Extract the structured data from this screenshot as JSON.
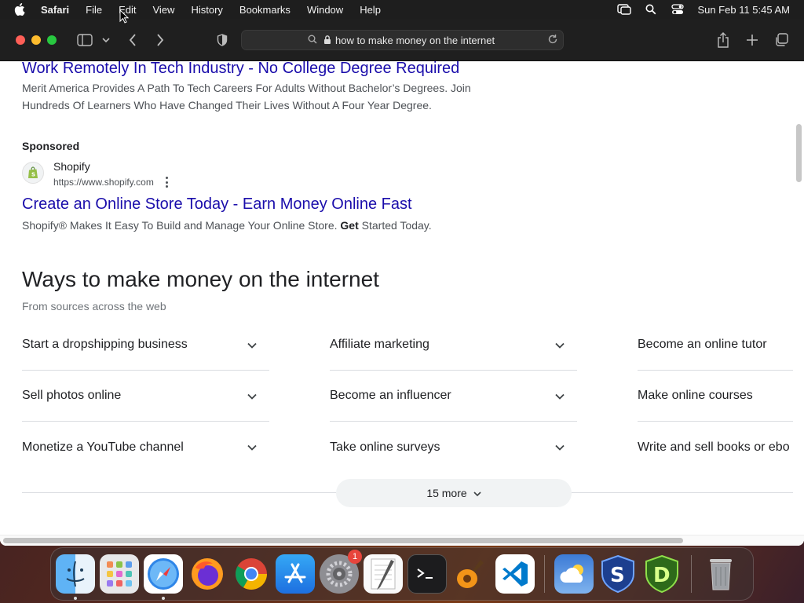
{
  "menubar": {
    "app_name": "Safari",
    "items": [
      "File",
      "Edit",
      "View",
      "History",
      "Bookmarks",
      "Window",
      "Help"
    ],
    "clock": "Sun Feb 11  5:45 AM"
  },
  "toolbar": {
    "address": "how to make money on the internet"
  },
  "ad1": {
    "title": "Work Remotely In Tech Industry - No College Degree Required",
    "description": "Merit America Provides A Path To Tech Careers For Adults Without Bachelor’s Degrees. Join Hundreds Of Learners Who Have Changed Their Lives Without A Four Year Degree."
  },
  "ad2": {
    "sponsored_label": "Sponsored",
    "site_name": "Shopify",
    "site_url": "https://www.shopify.com",
    "title": "Create an Online Store Today - Earn Money Online Fast",
    "description_pre": "Shopify® Makes It Easy To Build and Manage Your Online Store.",
    "description_bold": "Get",
    "description_post": "Started Today."
  },
  "ways": {
    "title": "Ways to make money on the internet",
    "subtitle": "From sources across the web",
    "items": [
      "Start a dropshipping business",
      "Affiliate marketing",
      "Become an online tutor",
      "Sell photos online",
      "Become an influencer",
      "Make online courses",
      "Monetize a YouTube channel",
      "Take online surveys",
      "Write and sell books or ebo"
    ],
    "more_label": "15 more"
  },
  "dock": {
    "apps": [
      "finder-icon",
      "launchpad-icon",
      "safari-icon",
      "firefox-icon",
      "chrome-icon",
      "app-store-icon",
      "system-settings-icon",
      "textedit-icon",
      "terminal-icon",
      "garageband-icon",
      "vscode-icon",
      "weather-icon",
      "s-app-icon",
      "d-app-icon",
      "trash-icon"
    ],
    "settings_badge": "1"
  }
}
